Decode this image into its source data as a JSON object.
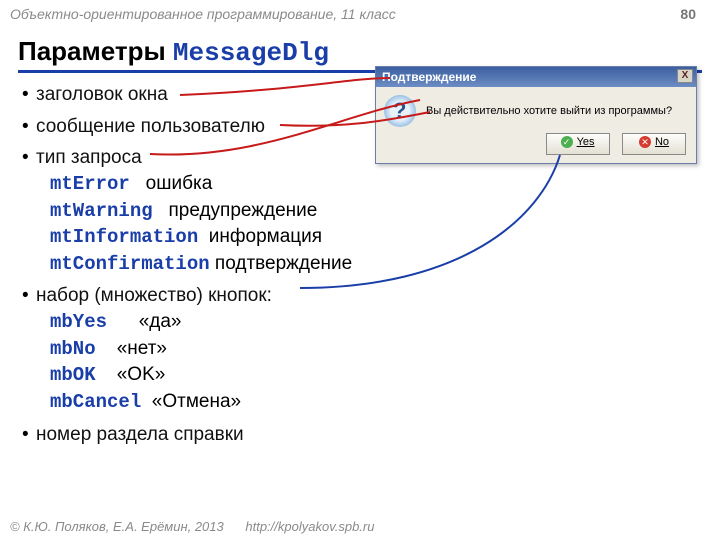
{
  "header": {
    "course": "Объектно-ориентированное программирование, 11 класс",
    "page": "80"
  },
  "title": {
    "text": "Параметры ",
    "code": "MessageDlg"
  },
  "bullets": {
    "b1": "заголовок окна",
    "b2": "сообщение пользователю",
    "b3": "тип запроса",
    "types": [
      {
        "code": "mtError",
        "desc": "ошибка"
      },
      {
        "code": "mtWarning",
        "desc": "предупреждение"
      },
      {
        "code": "mtInformation",
        "desc": "информация"
      },
      {
        "code": "mtConfirmation",
        "desc": "подтверждение"
      }
    ],
    "b4": "набор (множество) кнопок:",
    "buttons": [
      {
        "code": "mbYes",
        "desc": "«да»"
      },
      {
        "code": "mbNo",
        "desc": "«нет»"
      },
      {
        "code": "mbOK",
        "desc": "«OK»"
      },
      {
        "code": "mbCancel",
        "desc": "«Отмена»"
      }
    ],
    "b5": "номер раздела справки"
  },
  "dialog": {
    "title": "Подтверждение",
    "message": "Вы действительно хотите выйти из программы?",
    "yes": "Yes",
    "no": "No",
    "close": "X"
  },
  "footer": {
    "copyright": "© К.Ю. Поляков, Е.А. Ерёмин, 2013",
    "url": "http://kpolyakov.spb.ru"
  }
}
